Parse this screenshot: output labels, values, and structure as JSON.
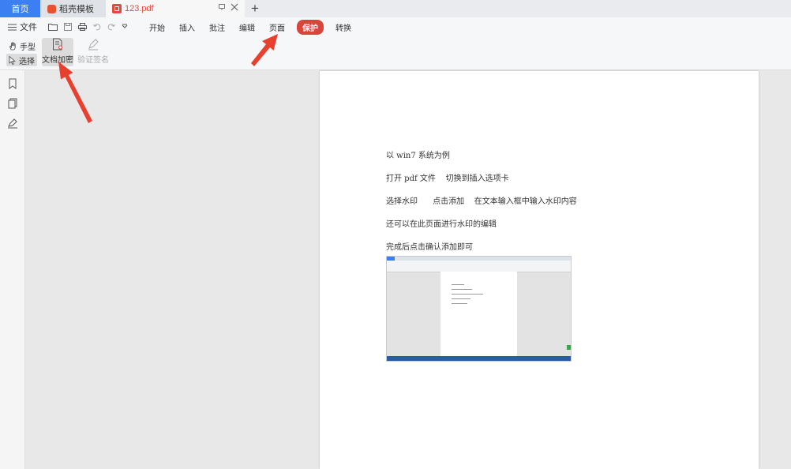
{
  "tabs": {
    "home": "首页",
    "templates": "稻壳模板",
    "document": "123.pdf"
  },
  "menu": {
    "file": "文件",
    "items": [
      "开始",
      "插入",
      "批注",
      "编辑",
      "页面",
      "保护",
      "转换"
    ],
    "active": "保护"
  },
  "ribbon": {
    "hand": "手型",
    "select": "选择",
    "encrypt": "文档加密",
    "verify_sign": "验证签名"
  },
  "document": {
    "lines": [
      "以 win7 系统为例",
      "打开 pdf 文件    切换到插入选项卡",
      "选择水印      点击添加    在文本输入框中输入水印内容",
      "还可以在此页面进行水印的编辑",
      "完成后点击确认添加即可"
    ]
  },
  "colors": {
    "accent": "#3c7ff2",
    "protect_tab": "#d9453b",
    "arrow": "#e8402f"
  }
}
